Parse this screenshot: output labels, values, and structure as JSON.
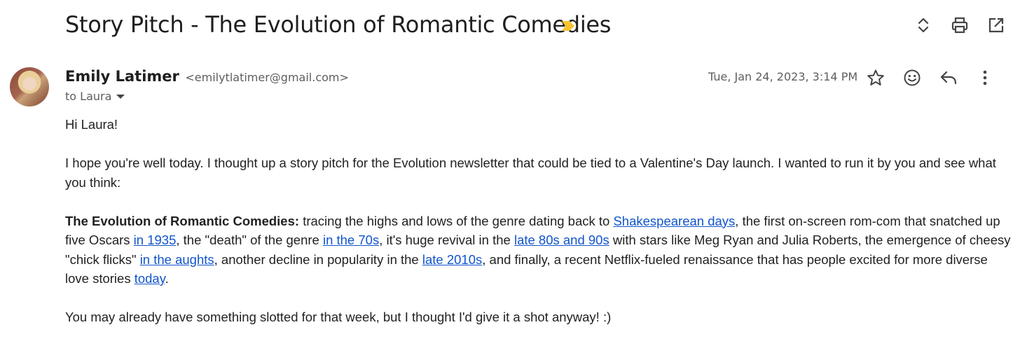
{
  "subject": "Story Pitch - The Evolution of Romantic Comedies",
  "icons": {
    "label": "important-label-icon",
    "expand": "expand-collapse-icon",
    "print": "print-icon",
    "open_new": "open-in-new-window-icon",
    "star": "star-icon",
    "emoji": "emoji-reaction-icon",
    "reply": "reply-icon",
    "more": "more-vert-icon"
  },
  "colors": {
    "label": "#f4c430",
    "link": "#1155cc"
  },
  "sender": {
    "name": "Emily Latimer",
    "email": "<emilytlatimer@gmail.com>",
    "to": "to Laura",
    "date": "Tue, Jan 24, 2023, 3:14 PM"
  },
  "body": {
    "greeting": "Hi Laura!",
    "p1": "I hope you're well today. I thought up a story pitch for the Evolution newsletter that could be tied to a Valentine's Day launch. I wanted to run it by you and see what you think:",
    "p2": {
      "bold": "The Evolution of Romantic Comedies:",
      "t1": " tracing the highs and lows of the genre dating back to ",
      "l1": "Shakespearean days",
      "t2": ", the first on-screen rom-com that snatched up five Oscars ",
      "l2": "in 1935",
      "t3": ", the \"death\" of the genre ",
      "l3": "in the 70s",
      "t4": ", it's huge revival in the ",
      "l4": "late 80s and 90s",
      "t5": " with stars like Meg Ryan and Julia Roberts, the emergence of cheesy \"chick flicks\" ",
      "l5": "in the aughts",
      "t6": ", another decline in popularity in the ",
      "l6": "late 2010s",
      "t7": ", and finally, a recent Netflix-fueled renaissance that has people excited for more diverse love stories ",
      "l7": "today",
      "t8": "."
    },
    "p3": "You may already have something slotted for that week, but I thought I'd give it a shot anyway! :)"
  }
}
